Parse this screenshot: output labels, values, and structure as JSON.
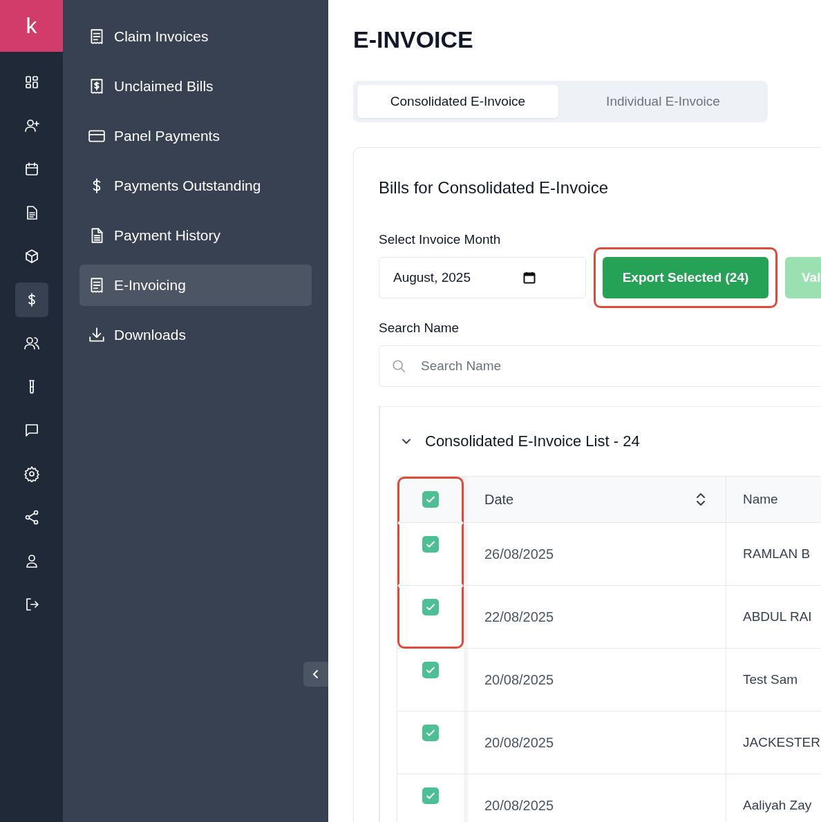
{
  "logo": {
    "letter": "k"
  },
  "rail": [
    {
      "selected": false
    },
    {
      "selected": false
    },
    {
      "selected": false
    },
    {
      "selected": false
    },
    {
      "selected": false
    },
    {
      "selected": true
    },
    {
      "selected": false
    },
    {
      "selected": false
    },
    {
      "selected": false
    },
    {
      "selected": false
    },
    {
      "selected": false
    },
    {
      "selected": false
    },
    {
      "selected": false
    }
  ],
  "sidebar": {
    "items": [
      {
        "label": "Claim Invoices",
        "selected": false
      },
      {
        "label": "Unclaimed Bills",
        "selected": false
      },
      {
        "label": "Panel Payments",
        "selected": false
      },
      {
        "label": "Payments Outstanding",
        "selected": false
      },
      {
        "label": "Payment History",
        "selected": false
      },
      {
        "label": "E-Invoicing",
        "selected": true
      },
      {
        "label": "Downloads",
        "selected": false
      }
    ]
  },
  "page_title": "E-INVOICE",
  "tabs": [
    {
      "label": "Consolidated E-Invoice",
      "selected": true
    },
    {
      "label": "Individual E-Invoice",
      "selected": false
    }
  ],
  "card": {
    "title": "Bills for Consolidated E-Invoice",
    "month_label": "Select Invoice Month",
    "month_value": "August, 2025",
    "export_button": {
      "label": "Export Selected (24)",
      "highlighted": true
    },
    "second_button": {
      "label": "Val"
    },
    "search_label": "Search Name",
    "search": {
      "placeholder": "Search Name"
    }
  },
  "list": {
    "title": "Consolidated E-Invoice List - 24",
    "expanded": true,
    "header": {
      "checked": true,
      "highlighted": true
    },
    "columns": [
      "Date",
      "Name"
    ],
    "rows": [
      {
        "checked": true,
        "highlighted": true,
        "date": "26/08/2025",
        "name": "RAMLAN B"
      },
      {
        "checked": true,
        "highlighted": true,
        "date": "22/08/2025",
        "name": "ABDUL RAI"
      },
      {
        "checked": true,
        "highlighted": false,
        "date": "20/08/2025",
        "name": "Test Sam"
      },
      {
        "checked": true,
        "highlighted": false,
        "date": "20/08/2025",
        "name": "JACKESTER"
      },
      {
        "checked": true,
        "highlighted": false,
        "date": "20/08/2025",
        "name": "Aaliyah Zay"
      }
    ]
  }
}
